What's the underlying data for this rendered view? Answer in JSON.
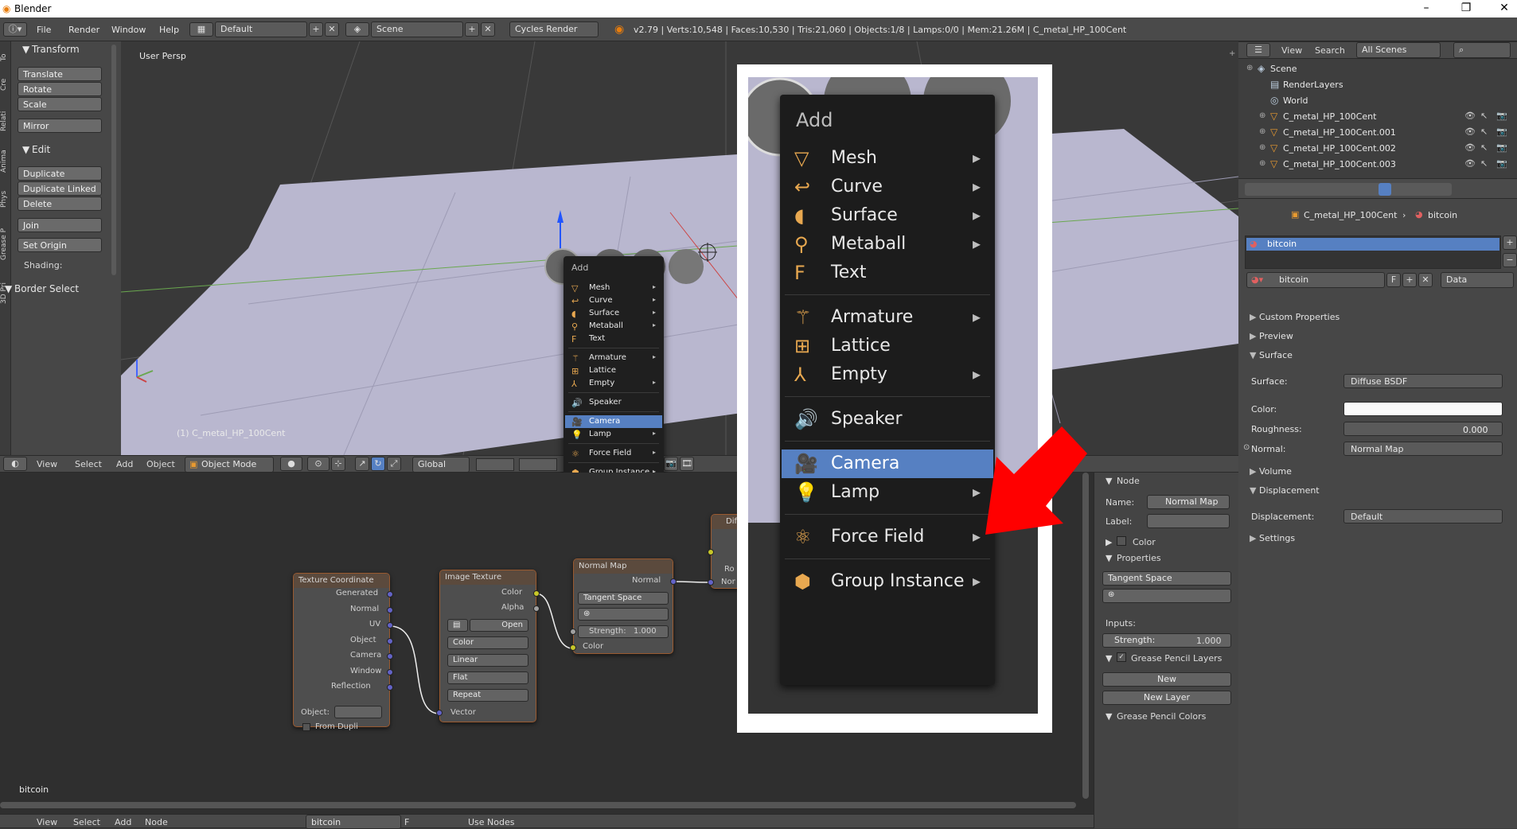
{
  "title_bar": {
    "app": "Blender"
  },
  "info_header": {
    "menus": [
      "File",
      "Render",
      "Window",
      "Help"
    ],
    "screen_layout": "Default",
    "scene": "Scene",
    "render_engine": "Cycles Render",
    "stats": "v2.79 | Verts:10,548 | Faces:10,530 | Tris:21,060 | Objects:1/8 | Lamps:0/0 | Mem:21.26M | C_metal_HP_100Cent"
  },
  "tool_shelf": {
    "tabs": [
      "To",
      "Cre",
      "Relati",
      "Anima",
      "Phys",
      "Grease P",
      "3D Pri"
    ],
    "transform_header": "Transform",
    "transform_buttons": [
      "Translate",
      "Rotate",
      "Scale"
    ],
    "mirror": "Mirror",
    "edit_header": "Edit",
    "edit_buttons": [
      "Duplicate",
      "Duplicate Linked",
      "Delete"
    ],
    "join": "Join",
    "set_origin": "Set Origin",
    "shading": "Shading:",
    "operator_header": "Border Select"
  },
  "viewport": {
    "label": "User Persp",
    "object_label": "(1) C_metal_HP_100Cent"
  },
  "viewport_header": {
    "menus": [
      "View",
      "Select",
      "Add",
      "Object"
    ],
    "mode": "Object Mode",
    "orientation": "Global"
  },
  "add_menu": {
    "title": "Add",
    "groups": [
      [
        {
          "label": "Mesh",
          "icon": "mesh-icon",
          "sub": true
        },
        {
          "label": "Curve",
          "icon": "curve-icon",
          "sub": true
        },
        {
          "label": "Surface",
          "icon": "surface-icon",
          "sub": true
        },
        {
          "label": "Metaball",
          "icon": "metaball-icon",
          "sub": true
        },
        {
          "label": "Text",
          "icon": "text-icon",
          "sub": false
        }
      ],
      [
        {
          "label": "Armature",
          "icon": "armature-icon",
          "sub": true
        },
        {
          "label": "Lattice",
          "icon": "lattice-icon",
          "sub": false
        },
        {
          "label": "Empty",
          "icon": "empty-icon",
          "sub": true
        }
      ],
      [
        {
          "label": "Speaker",
          "icon": "speaker-icon",
          "sub": false
        }
      ],
      [
        {
          "label": "Camera",
          "icon": "camera-icon",
          "sub": false,
          "highlighted": true
        },
        {
          "label": "Lamp",
          "icon": "lamp-icon",
          "sub": true
        }
      ],
      [
        {
          "label": "Force Field",
          "icon": "force-field-icon",
          "sub": true
        }
      ],
      [
        {
          "label": "Group Instance",
          "icon": "group-instance-icon",
          "sub": true
        }
      ]
    ]
  },
  "node_editor": {
    "nodes": {
      "texcoord": {
        "title": "Texture Coordinate",
        "outputs": [
          "Generated",
          "Normal",
          "UV",
          "Object",
          "Camera",
          "Window",
          "Reflection"
        ],
        "object_label": "Object:",
        "from_dupli": "From Dupli"
      },
      "image": {
        "title": "Image Texture",
        "outputs": [
          "Color",
          "Alpha"
        ],
        "open": "Open",
        "options": [
          "Color",
          "Linear",
          "Flat",
          "Repeat"
        ],
        "input": "Vector"
      },
      "normalmap": {
        "title": "Normal Map",
        "output": "Normal",
        "space": "Tangent Space",
        "strength_label": "Strength:",
        "strength": "1.000",
        "input": "Color"
      },
      "diffuse": {
        "title": "Dif",
        "ro": "Ro",
        "nor": "Nor"
      }
    },
    "material_label": "bitcoin"
  },
  "node_header": {
    "menus": [
      "View",
      "Select",
      "Add",
      "Node"
    ],
    "material": "bitcoin",
    "fake": "F",
    "use_nodes": "Use Nodes"
  },
  "node_npanel": {
    "node_header": "Node",
    "name_label": "Name:",
    "name": "Normal Map",
    "label_label": "Label:",
    "color": "Color",
    "properties": "Properties",
    "space": "Tangent Space",
    "inputs": "Inputs:",
    "strength_label": "Strength:",
    "strength": "1.000",
    "gp_layers": "Grease Pencil Layers",
    "new": "New",
    "new_layer": "New Layer",
    "gp_colors": "Grease Pencil Colors"
  },
  "outliner": {
    "menus": [
      "View",
      "Search"
    ],
    "filter": "All Scenes",
    "items": [
      "Scene",
      "RenderLayers",
      "World",
      "C_metal_HP_100Cent",
      "C_metal_HP_100Cent.001",
      "C_metal_HP_100Cent.002",
      "C_metal_HP_100Cent.003"
    ]
  },
  "properties": {
    "breadcrumb_object": "C_metal_HP_100Cent",
    "breadcrumb_material": "bitcoin",
    "slot": "bitcoin",
    "material_name": "bitcoin",
    "fake": "F",
    "link": "Data",
    "panels": [
      "Custom Properties",
      "Preview",
      "Surface"
    ],
    "surface_label": "Surface:",
    "surface": "Diffuse BSDF",
    "color_label": "Color:",
    "roughness_label": "Roughness:",
    "roughness": "0.000",
    "normal_label": "Normal:",
    "normal": "Normal Map",
    "volume": "Volume",
    "displacement_header": "Displacement",
    "displacement_label": "Displacement:",
    "displacement": "Default",
    "settings": "Settings"
  },
  "colors": {
    "highlight": "#5680c2",
    "arrow": "#ff0000",
    "node_border": "#9a5a30"
  }
}
